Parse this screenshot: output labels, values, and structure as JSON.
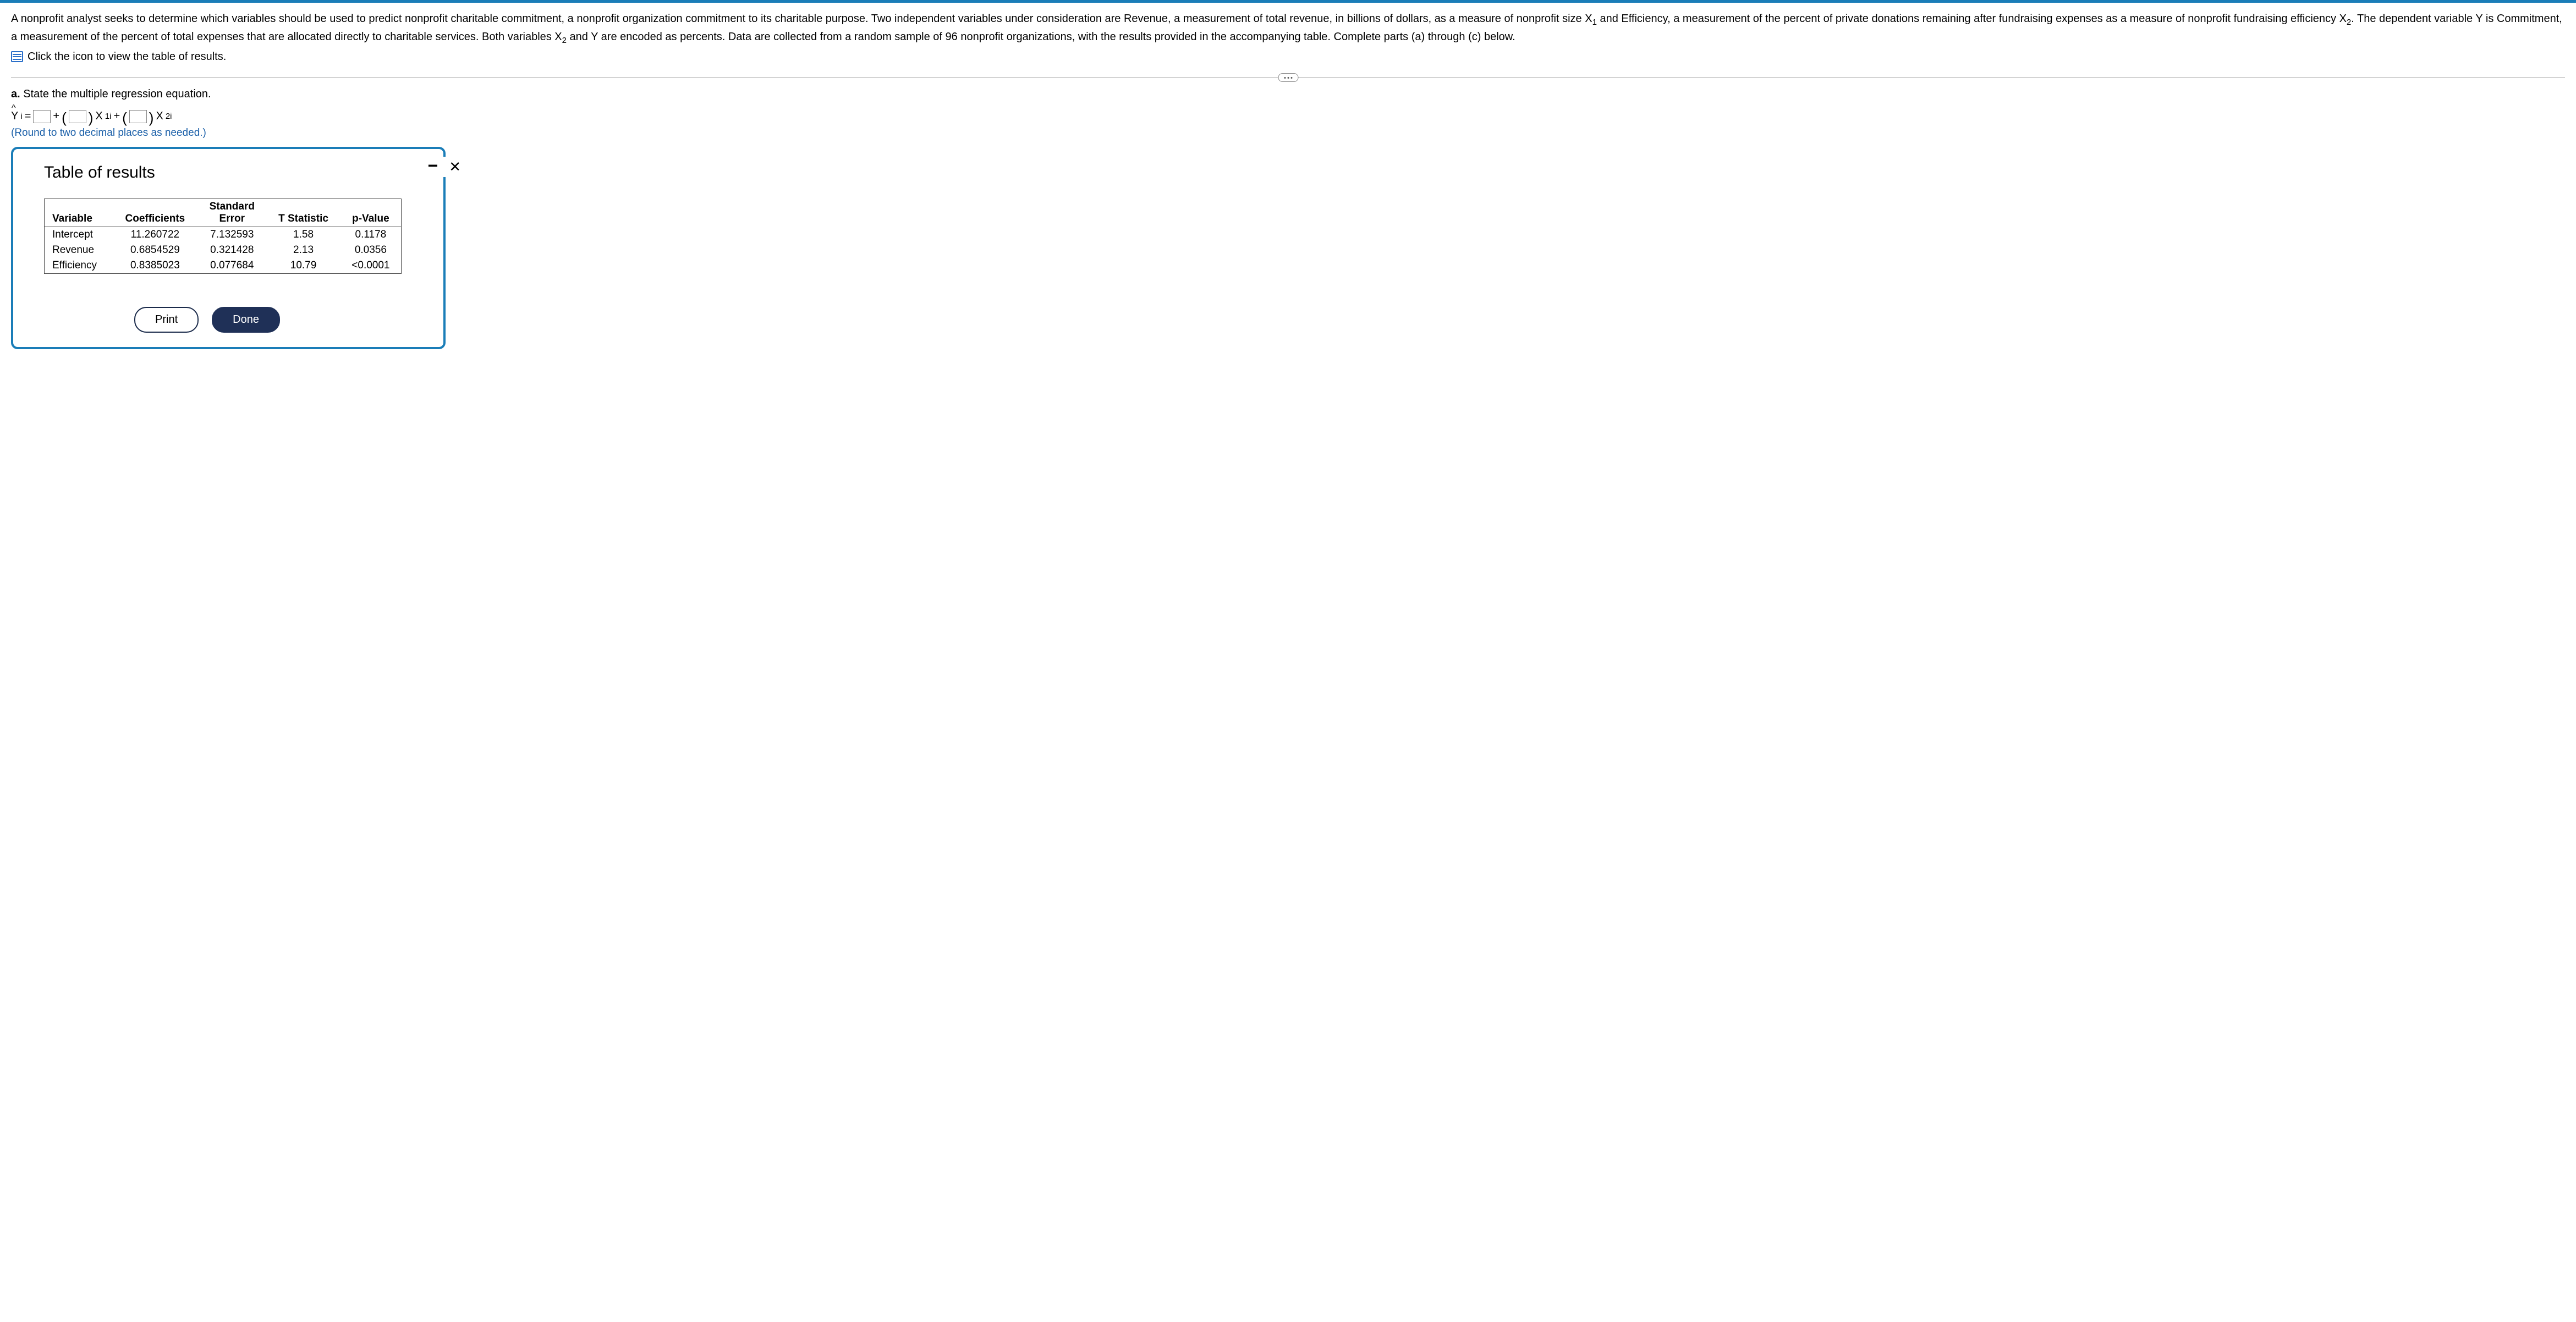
{
  "problem": {
    "p1": "A nonprofit analyst seeks to determine which variables should be used to predict nonprofit charitable commitment, a nonprofit organization commitment to its charitable purpose. Two independent variables under consideration are Revenue, a measurement of total revenue, in billions of dollars, as a measure of nonprofit size X",
    "x1sub": "1",
    "p1b": " and Efficiency, a measurement of the percent of private donations remaining after fundraising expenses as a measure of nonprofit fundraising efficiency X",
    "x2sub": "2",
    "p1c": ". The dependent variable Y is Commitment, a measurement of the percent of total expenses that are allocated directly to charitable services. Both variables X",
    "x2sub2": "2",
    "p1d": " and Y are encoded as percents. Data are collected from a random sample of 96 nonprofit organizations, with the results provided in the accompanying table. Complete parts (a) through (c) below.",
    "icon_link": "Click the icon to view the table of results."
  },
  "part_a": {
    "label": "a.",
    "text": " State the multiple regression equation.",
    "yhat": "Y",
    "ysub": "i",
    "eq": " =",
    "plus": "+",
    "x1": "X",
    "x1sub": "1i",
    "x2": "X",
    "x2sub": "2i",
    "hint": "(Round to two decimal places as needed.)"
  },
  "modal": {
    "title": "Table of results",
    "headers": {
      "variable": "Variable",
      "coefficients": "Coefficients",
      "stderr_l1": "Standard",
      "stderr_l2": "Error",
      "tstat": "T Statistic",
      "pvalue": "p-Value"
    },
    "rows": [
      {
        "variable": "Intercept",
        "coef": "11.260722",
        "se": "7.132593",
        "t": "1.58",
        "p": "0.1178"
      },
      {
        "variable": "Revenue",
        "coef": "0.6854529",
        "se": "0.321428",
        "t": "2.13",
        "p": "0.0356"
      },
      {
        "variable": "Efficiency",
        "coef": "0.8385023",
        "se": "0.077684",
        "t": "10.79",
        "p": "<0.0001"
      }
    ],
    "print": "Print",
    "done": "Done"
  }
}
